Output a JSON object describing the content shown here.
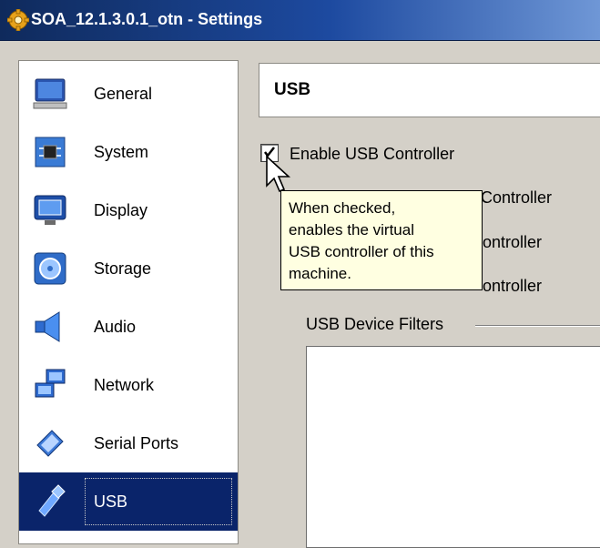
{
  "window": {
    "title": "SOA_12.1.3.0.1_otn - Settings",
    "icon": "gear-icon"
  },
  "sidebar": {
    "items": [
      {
        "label": "General",
        "icon": "monitor-icon"
      },
      {
        "label": "System",
        "icon": "chip-icon"
      },
      {
        "label": "Display",
        "icon": "display-icon"
      },
      {
        "label": "Storage",
        "icon": "storage-disk-icon"
      },
      {
        "label": "Audio",
        "icon": "speaker-icon"
      },
      {
        "label": "Network",
        "icon": "network-icon"
      },
      {
        "label": "Serial Ports",
        "icon": "serial-port-icon"
      },
      {
        "label": "USB",
        "icon": "usb-icon",
        "selected": true
      }
    ]
  },
  "main": {
    "section_title": "USB",
    "enable_usb": {
      "label": "Enable USB Controller",
      "checked": true
    },
    "controllers": [
      {
        "label_visible_fragment": "Controller"
      },
      {
        "label_visible_fragment": "ontroller"
      },
      {
        "label_visible_fragment": "ontroller"
      }
    ],
    "filters_group_label": "USB Device Filters"
  },
  "tooltip": {
    "lines": [
      "When checked,",
      "enables the virtual",
      "USB controller of this",
      "machine."
    ]
  },
  "colors": {
    "selection": "#0a246a",
    "tooltip_bg": "#ffffe1",
    "titlebar": "#0f2a5c"
  }
}
